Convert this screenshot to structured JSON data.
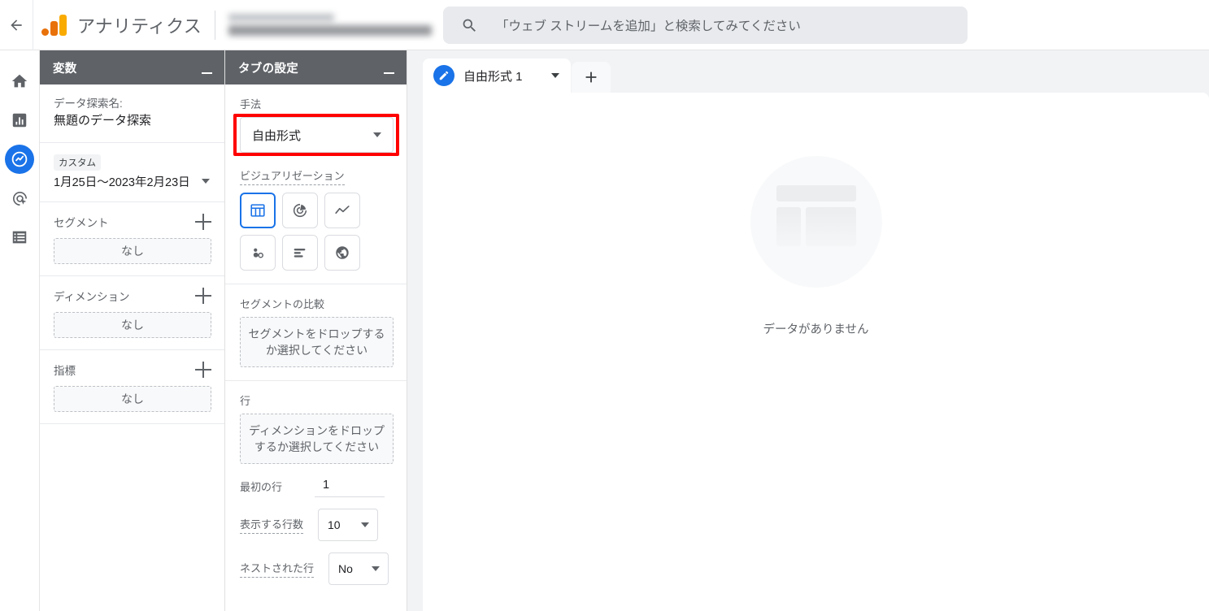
{
  "topbar": {
    "back_label": "←",
    "brand": "アナリティクス",
    "property_name_blurred": "",
    "search_placeholder": "「ウェブ ストリームを追加」と検索してみてください"
  },
  "rail": {
    "items": [
      {
        "name": "home",
        "icon": "home-icon"
      },
      {
        "name": "reports",
        "icon": "bar-chart-icon"
      },
      {
        "name": "explore",
        "icon": "explore-icon",
        "active": true
      },
      {
        "name": "advertising",
        "icon": "target-cursor-icon"
      },
      {
        "name": "configure",
        "icon": "list-icon"
      }
    ]
  },
  "variables_panel": {
    "title": "変数",
    "exploration_name_label": "データ探索名:",
    "exploration_name_value": "無題のデータ探索",
    "date_badge": "カスタム",
    "date_range": "1月25日〜2023年2月23日",
    "sections": [
      {
        "title": "セグメント",
        "value": "なし"
      },
      {
        "title": "ディメンション",
        "value": "なし"
      },
      {
        "title": "指標",
        "value": "なし"
      }
    ]
  },
  "tab_settings_panel": {
    "title": "タブの設定",
    "technique_label": "手法",
    "technique_value": "自由形式",
    "visualization_label": "ビジュアリゼーション",
    "visualizations": [
      {
        "name": "free-form-table",
        "icon": "table-icon",
        "active": true
      },
      {
        "name": "donut-chart",
        "icon": "donut-chart-icon",
        "active": false
      },
      {
        "name": "line-chart",
        "icon": "line-chart-icon",
        "active": false
      },
      {
        "name": "scatter-plot",
        "icon": "scatter-plot-icon",
        "active": false
      },
      {
        "name": "bar-chart",
        "icon": "bar-chart-icon",
        "active": false
      },
      {
        "name": "geo-map",
        "icon": "globe-icon",
        "active": false
      }
    ],
    "segment_compare_label": "セグメントの比較",
    "segment_dropzone": "セグメントをドロップするか選択してください",
    "rows_label": "行",
    "rows_dropzone": "ディメンションをドロップするか選択してください",
    "start_row_label": "最初の行",
    "start_row_value": "1",
    "show_rows_label": "表示する行数",
    "show_rows_value": "10",
    "nested_rows_label": "ネストされた行",
    "nested_rows_value": "No"
  },
  "main": {
    "tab_label": "自由形式 1",
    "add_tab_label": "+",
    "empty_state_text": "データがありません"
  },
  "colors": {
    "accent_blue": "#1a73e8",
    "panel_header_gray": "#5f6368",
    "annotation_red": "#ff0000",
    "logo_orange_dark": "#e8710a",
    "logo_orange_light": "#f9ab00",
    "canvas_bg": "#f1f3f4"
  }
}
